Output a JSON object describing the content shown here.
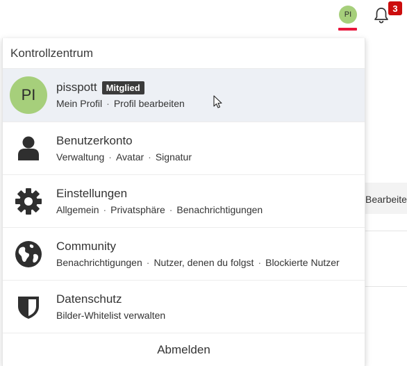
{
  "topbar": {
    "avatar_initials": "PI",
    "notification_count": "3",
    "accent_color": "#e8163c",
    "icons": [
      "avatar",
      "bell-icon"
    ]
  },
  "background": {
    "partial_text": "Bearbeite"
  },
  "panel": {
    "title": "Kontrollzentrum",
    "profile": {
      "initials": "PI",
      "username": "pisspott",
      "badge": "Mitglied",
      "links": [
        "Mein Profil",
        "Profil bearbeiten"
      ]
    },
    "items": [
      {
        "title": "Benutzerkonto",
        "icon": "user-icon",
        "links": [
          "Verwaltung",
          "Avatar",
          "Signatur"
        ]
      },
      {
        "title": "Einstellungen",
        "icon": "gear-icon",
        "links": [
          "Allgemein",
          "Privatsphäre",
          "Benachrichtigungen"
        ]
      },
      {
        "title": "Community",
        "icon": "globe-icon",
        "links": [
          "Benachrichtigungen",
          "Nutzer, denen du folgst",
          "Blockierte Nutzer"
        ]
      },
      {
        "title": "Datenschutz",
        "icon": "shield-icon",
        "links": [
          "Bilder-Whitelist verwalten"
        ]
      }
    ],
    "logout_label": "Abmelden",
    "separator": "·"
  }
}
